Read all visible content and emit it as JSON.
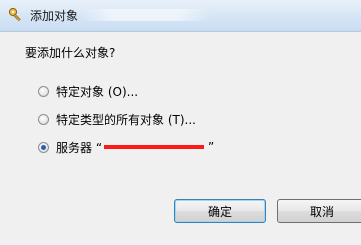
{
  "window": {
    "title": "添加对象"
  },
  "dialog": {
    "question": "要添加什么对象?",
    "options": [
      {
        "label": "特定对象 (O)...",
        "checked": false
      },
      {
        "label": "特定类型的所有对象 (T)...",
        "checked": false
      },
      {
        "label": "服务器 “",
        "suffix": "”",
        "checked": true
      }
    ]
  },
  "buttons": {
    "ok": "确定",
    "cancel": "取消"
  },
  "colors": {
    "redaction": "#ff1a1a",
    "titlebar": "#d7e6f5"
  }
}
